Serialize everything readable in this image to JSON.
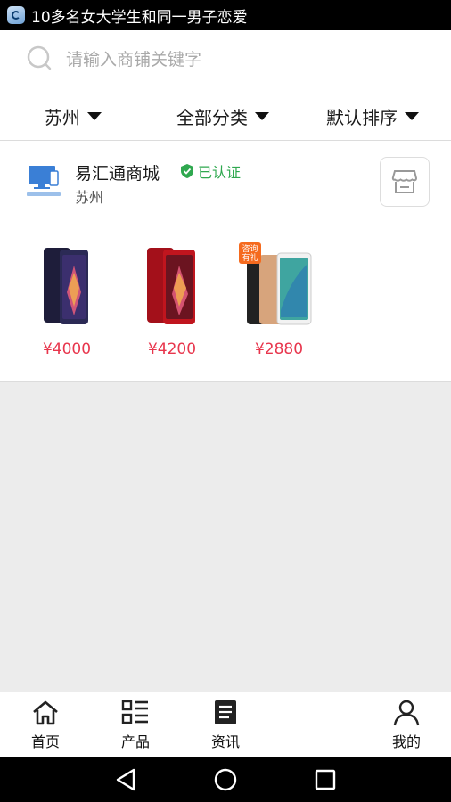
{
  "status_bar": {
    "notification_text": "10多名女大学生和同一男子恋爱"
  },
  "search": {
    "placeholder": "请输入商铺关键字",
    "icon": "search-icon"
  },
  "filters": [
    {
      "label": "苏州",
      "icon": "caret-down-icon"
    },
    {
      "label": "全部分类",
      "icon": "caret-down-icon"
    },
    {
      "label": "默认排序",
      "icon": "caret-down-icon"
    }
  ],
  "shop": {
    "name": "易汇通商城",
    "verified_label": "已认证",
    "city": "苏州",
    "logo_icon": "computer-phone-logo",
    "store_icon": "store-icon",
    "products": [
      {
        "price": "¥4000",
        "color": "#2b2a55"
      },
      {
        "price": "¥4200",
        "color": "#c0151e"
      },
      {
        "price": "¥2880",
        "color": "#d7a47c",
        "badge": "咨询有礼"
      }
    ]
  },
  "bottom_nav": [
    {
      "label": "首页",
      "icon": "home-icon"
    },
    {
      "label": "产品",
      "icon": "list-icon"
    },
    {
      "label": "资讯",
      "icon": "news-icon"
    },
    {
      "label": "我的",
      "icon": "user-icon"
    }
  ],
  "colors": {
    "accent_price": "#e8364d",
    "verified": "#2fa84f"
  }
}
